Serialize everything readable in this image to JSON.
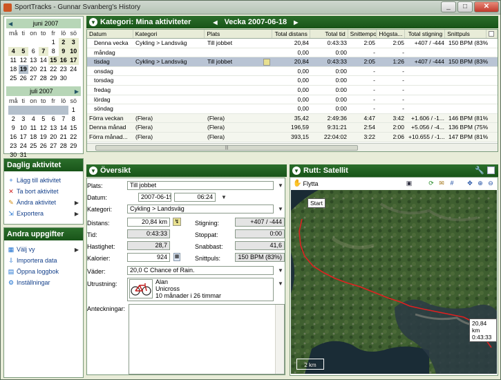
{
  "window": {
    "title": "SportTracks - Gunnar Svanberg's History",
    "buttons": [
      "_",
      "□",
      "✕"
    ]
  },
  "calendar": {
    "months": [
      {
        "name": "juni 2007",
        "nav_left": "◀",
        "nav_right": "",
        "weekdays": [
          "må",
          "ti",
          "on",
          "to",
          "fr",
          "lö",
          "sö"
        ],
        "days": [
          "",
          "",
          "",
          "",
          "1",
          "2",
          "3",
          "4",
          "5",
          "6",
          "7",
          "8",
          "9",
          "10",
          "11",
          "12",
          "13",
          "14",
          "15",
          "16",
          "17",
          "18",
          "19",
          "20",
          "21",
          "22",
          "23",
          "24",
          "25",
          "26",
          "27",
          "28",
          "29",
          "30",
          ""
        ],
        "bold": [
          "2",
          "3",
          "4",
          "5",
          "7",
          "9",
          "10",
          "15",
          "16",
          "17"
        ],
        "selected": "19"
      },
      {
        "name": "juli 2007",
        "nav_left": "",
        "nav_right": "▶",
        "weekdays": [
          "må",
          "ti",
          "on",
          "to",
          "fr",
          "lö",
          "sö"
        ],
        "days": [
          "",
          "",
          "",
          "",
          "",
          "",
          "1",
          "2",
          "3",
          "4",
          "5",
          "6",
          "7",
          "8",
          "9",
          "10",
          "11",
          "12",
          "13",
          "14",
          "15",
          "16",
          "17",
          "18",
          "19",
          "20",
          "21",
          "22",
          "23",
          "24",
          "25",
          "26",
          "27",
          "28",
          "29",
          "30",
          "31"
        ],
        "bold": [],
        "selected": ""
      }
    ]
  },
  "daily": {
    "title": "Daglig aktivitet",
    "items": [
      {
        "label": "Lägg till aktivitet",
        "icon": "+",
        "color": "#1a6fd0",
        "arrow": ""
      },
      {
        "label": "Ta bort aktivitet",
        "icon": "✕",
        "color": "#d02020",
        "arrow": ""
      },
      {
        "label": "Ändra aktivitet",
        "icon": "✎",
        "color": "#d08a10",
        "arrow": "▶"
      },
      {
        "label": "Exportera",
        "icon": "⇲",
        "color": "#1a6fd0",
        "arrow": "▶"
      }
    ]
  },
  "other": {
    "title": "Andra uppgifter",
    "items": [
      {
        "label": "Välj vy",
        "icon": "▦",
        "color": "#1a6fd0",
        "arrow": "▶"
      },
      {
        "label": "Importera data",
        "icon": "⇩",
        "color": "#1a6fd0",
        "arrow": ""
      },
      {
        "label": "Öppna loggbok",
        "icon": "▤",
        "color": "#1a6fd0",
        "arrow": ""
      },
      {
        "label": "Inställningar",
        "icon": "⚙",
        "color": "#1a6fd0",
        "arrow": ""
      }
    ]
  },
  "category": {
    "title": "Kategori: Mina aktiviteter",
    "week": "Vecka 2007-06-18",
    "prev": "◀",
    "next": "▶"
  },
  "table": {
    "columns": [
      "Datum",
      "Kategori",
      "Plats",
      "Total distans",
      "Total tid",
      "Snittempo",
      "Högsta...",
      "Total stigning",
      "Snittpuls"
    ],
    "rows": [
      {
        "cells": [
          "Denna vecka",
          "Cykling > Landsväg",
          "Till jobbet",
          "20,84",
          "0:43:33",
          "2:05",
          "2:05",
          "+407 / -444",
          "150 BPM (83%)"
        ],
        "style": ""
      },
      {
        "cells": [
          "måndag",
          "",
          "",
          "0,00",
          "0:00",
          "-",
          "-",
          "",
          ""
        ],
        "style": ""
      },
      {
        "cells": [
          "tisdag",
          "Cykling > Landsväg",
          "Till jobbet",
          "20,84",
          "0:43:33",
          "2:05",
          "1:26",
          "+407 / -444",
          "150 BPM (83%)"
        ],
        "style": "sel"
      },
      {
        "cells": [
          "onsdag",
          "",
          "",
          "0,00",
          "0:00",
          "-",
          "-",
          "",
          ""
        ],
        "style": ""
      },
      {
        "cells": [
          "torsdag",
          "",
          "",
          "0,00",
          "0:00",
          "-",
          "-",
          "",
          ""
        ],
        "style": ""
      },
      {
        "cells": [
          "fredag",
          "",
          "",
          "0,00",
          "0:00",
          "-",
          "-",
          "",
          ""
        ],
        "style": ""
      },
      {
        "cells": [
          "lördag",
          "",
          "",
          "0,00",
          "0:00",
          "-",
          "-",
          "",
          ""
        ],
        "style": ""
      },
      {
        "cells": [
          "söndag",
          "",
          "",
          "0,00",
          "0:00",
          "-",
          "-",
          "",
          ""
        ],
        "style": ""
      },
      {
        "cells": [
          "Förra veckan",
          "(Flera)",
          "(Flera)",
          "35,42",
          "2:49:36",
          "4:47",
          "3:42",
          "+1.606 / -1...",
          "146 BPM (81%)"
        ],
        "style": "sum"
      },
      {
        "cells": [
          "Denna månad",
          "(Flera)",
          "(Flera)",
          "196,59",
          "9:31:21",
          "2:54",
          "2:00",
          "+5.056 / -4...",
          "136 BPM (75%)"
        ],
        "style": "sum"
      },
      {
        "cells": [
          "Förra månad...",
          "(Flera)",
          "(Flera)",
          "393,15",
          "22:04:02",
          "3:22",
          "2:06",
          "+10.655 / -1...",
          "147 BPM (81%)"
        ],
        "style": "sum"
      }
    ]
  },
  "overview": {
    "title": "Översikt",
    "place_label": "Plats:",
    "place": "Till jobbet",
    "date_label": "Datum:",
    "date": "2007-06-19",
    "time": "06:24",
    "category_label": "Kategori:",
    "category": "Cykling > Landsväg",
    "distance_label": "Distans:",
    "distance": "20,84 km",
    "climb_label": "Stigning:",
    "climb": "+407 / -444",
    "time_label": "Tid:",
    "duration": "0:43:33",
    "stopped_label": "Stoppat:",
    "stopped": "0:00",
    "speed_label": "Hastighet:",
    "speed": "28,7",
    "max_label": "Snabbast:",
    "max": "41,6",
    "cal_label": "Kalorier:",
    "calories": "924",
    "hr_label": "Snittpuls:",
    "hr": "150 BPM (83%)",
    "weather_label": "Väder:",
    "weather": "20,0 C Chance of Rain.",
    "equip_label": "Utrustning:",
    "equip_lines": [
      "Alan",
      "Unicross",
      "10 månader i 26 timmar"
    ],
    "notes_label": "Anteckningar:"
  },
  "route": {
    "title": "Rutt: Satellit",
    "move_label": "Flytta",
    "start_label": "Start",
    "end_distance": "20,84 km",
    "end_time": "0:43:33",
    "scale": "2 km"
  },
  "colors": {
    "header_green": "#185418",
    "route": "#e02020",
    "selected_row": "#b9c4d4"
  }
}
